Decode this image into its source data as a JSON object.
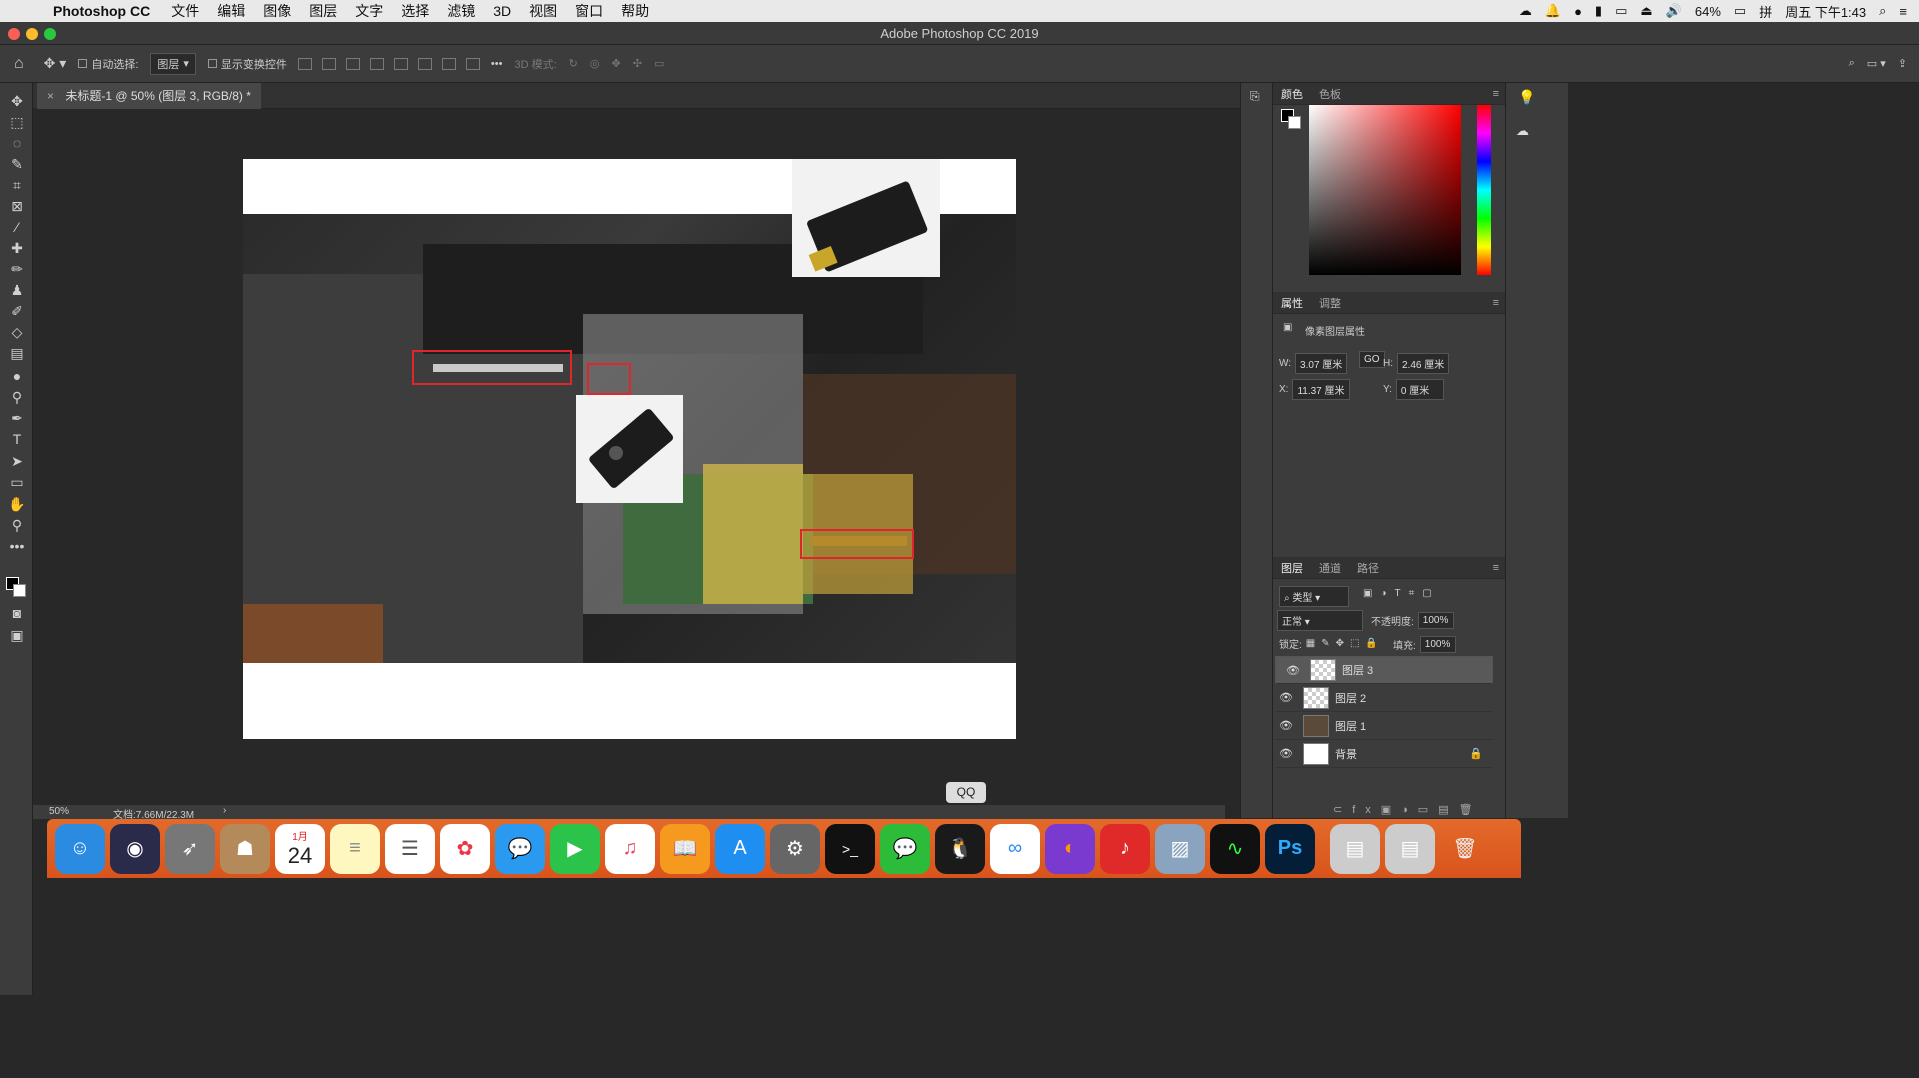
{
  "menubar": {
    "app": "Photoshop CC",
    "items": [
      "文件",
      "编辑",
      "图像",
      "图层",
      "文字",
      "选择",
      "滤镜",
      "3D",
      "视图",
      "窗口",
      "帮助"
    ],
    "battery": "64%",
    "clock": "周五 下午1:43"
  },
  "window": {
    "title": "Adobe Photoshop CC 2019"
  },
  "options": {
    "auto_select": "自动选择:",
    "auto_select_value": "图层",
    "show_transform": "显示变换控件",
    "mode3d": "3D 模式:"
  },
  "document": {
    "tab": "未标题-1 @ 50% (图层 3, RGB/8) *",
    "zoom": "50%",
    "doc_size": "文档:7.66M/22.3M"
  },
  "panels": {
    "color_tabs": [
      "颜色",
      "色板"
    ],
    "props_tabs": [
      "属性",
      "调整"
    ],
    "props_title": "像素图层属性",
    "w_label": "W:",
    "w": "3.07 厘米",
    "h_label": "H:",
    "h": "2.46 厘米",
    "x_label": "X:",
    "x": "11.37 厘米",
    "y_label": "Y:",
    "y": "0 厘米",
    "link": "GO",
    "layers_tabs": [
      "图层",
      "通道",
      "路径"
    ],
    "filter_kind": "类型",
    "blend_mode": "正常",
    "opacity_label": "不透明度:",
    "opacity": "100%",
    "lock_label": "锁定:",
    "fill_label": "填充:",
    "fill": "100%",
    "layers": [
      {
        "name": "图层 3",
        "selected": true
      },
      {
        "name": "图层 2",
        "selected": false
      },
      {
        "name": "图层 1",
        "selected": false
      },
      {
        "name": "背景",
        "selected": false
      }
    ]
  },
  "dock": {
    "tooltip": "QQ",
    "calendar_month": "1月",
    "calendar_day": "24",
    "ps_label": "Ps"
  }
}
